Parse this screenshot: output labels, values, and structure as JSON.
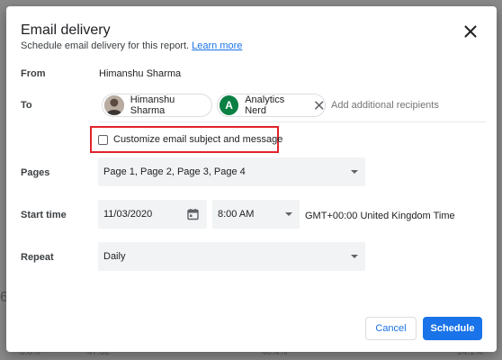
{
  "dialog": {
    "title": "Email delivery",
    "subtitle": "Schedule email delivery for this report.",
    "learn_more": "Learn more"
  },
  "from": {
    "label": "From",
    "value": "Himanshu Sharma"
  },
  "to": {
    "label": "To",
    "recipients": [
      {
        "name": "Himanshu Sharma",
        "avatar": "photo"
      },
      {
        "name": "Analytics Nerd",
        "avatar_letter": "A"
      }
    ],
    "placeholder": "Add additional recipients"
  },
  "customize": {
    "label": "Customize email subject and message",
    "checked": false
  },
  "pages": {
    "label": "Pages",
    "value": "Page 1, Page 2, Page 3, Page 4"
  },
  "start_time": {
    "label": "Start time",
    "date": "11/03/2020",
    "time": "8:00 AM",
    "timezone": "GMT+00:00 United Kingdom Time"
  },
  "repeat": {
    "label": "Repeat",
    "value": "Daily"
  },
  "buttons": {
    "cancel": "Cancel",
    "schedule": "Schedule"
  },
  "background": {
    "left_number": "6",
    "row_values": [
      "0.0%",
      "47.62",
      "40.4%",
      "14.1%"
    ]
  },
  "colors": {
    "accent": "#1a73e8",
    "highlight": "#e2232b",
    "avatar_green": "#0b8043"
  },
  "icons": {
    "close": "close-icon",
    "calendar": "calendar-icon",
    "chip_remove": "close-icon"
  }
}
